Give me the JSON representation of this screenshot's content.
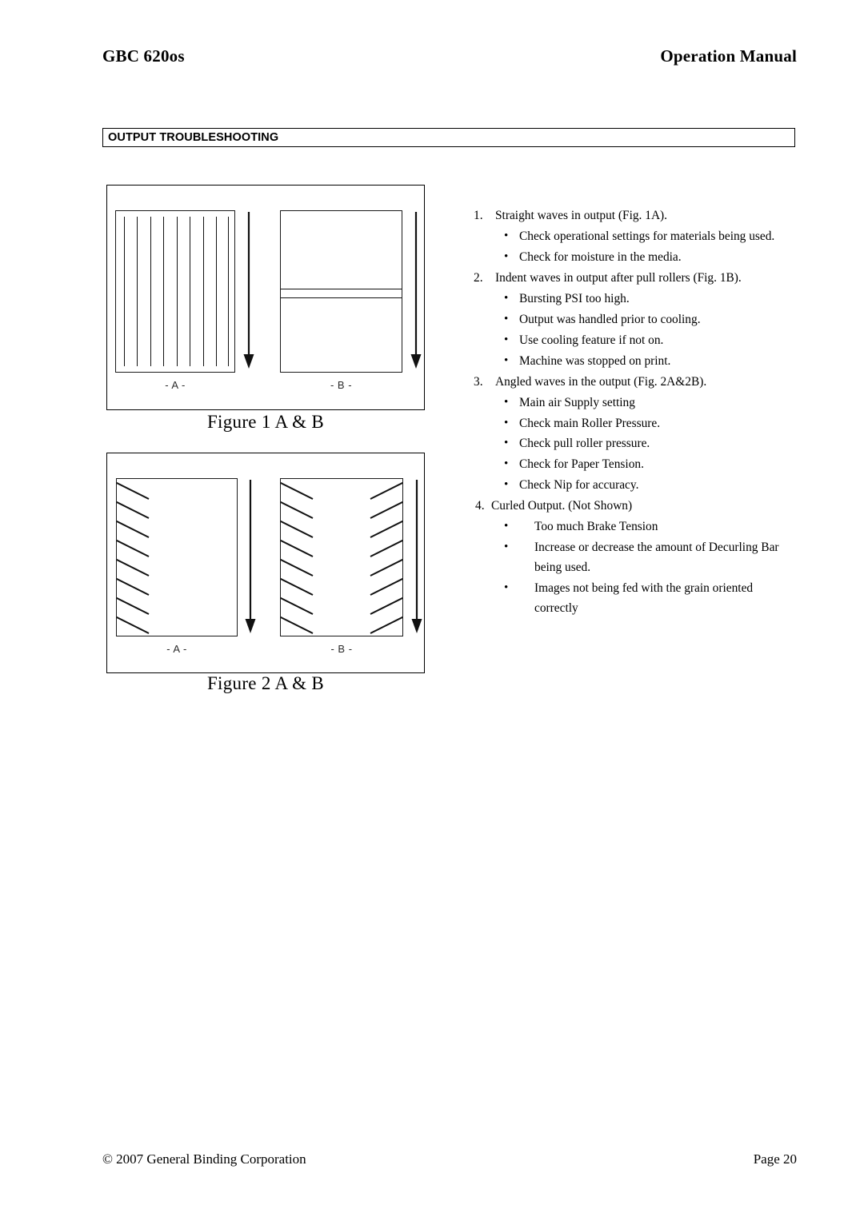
{
  "header": {
    "left_title": "GBC 620os",
    "right_title": "Operation Manual"
  },
  "section": {
    "title": "OUTPUT TROUBLESHOOTING"
  },
  "figures": [
    {
      "caption": "Figure 1 A & B",
      "panels": [
        {
          "label": "- A -",
          "pattern": "vertical-straight-waves",
          "line_count": 9,
          "arrow": "down"
        },
        {
          "label": "- B -",
          "pattern": "horizontal-indent-band",
          "line_count": 2,
          "arrow": "down"
        }
      ]
    },
    {
      "caption": "Figure 2 A & B",
      "panels": [
        {
          "label": "- A -",
          "pattern": "angled-waves-left",
          "line_count": 8,
          "arrow": "down"
        },
        {
          "label": "- B -",
          "pattern": "angled-waves-both-sides",
          "line_count": 16,
          "arrow": "down"
        }
      ]
    }
  ],
  "troubleshooting": [
    {
      "number": "1.",
      "text": "Straight waves in output (Fig. 1A).",
      "bullets": [
        "Check operational settings for materials being used.",
        "Check for moisture in the media."
      ]
    },
    {
      "number": "2.",
      "text": "Indent waves in output after pull rollers (Fig. 1B).",
      "bullets": [
        "Bursting PSI too high.",
        "Output was handled prior to cooling.",
        "Use cooling feature if not on.",
        "Machine was stopped on print."
      ]
    },
    {
      "number": "3.",
      "text": "Angled waves in the output (Fig. 2A&2B).",
      "bullets": [
        "Main air Supply setting",
        "Check main Roller Pressure.",
        "Check pull roller pressure.",
        "Check for Paper Tension.",
        "Check Nip for accuracy."
      ]
    },
    {
      "number": "4.",
      "text": "Curled Output. (Not Shown)",
      "bullets": [
        "Too much Brake Tension",
        "Increase or decrease the amount of Decurling Bar being used.",
        "Images not being fed with the grain oriented correctly"
      ]
    }
  ],
  "footer": {
    "copyright": "© 2007 General Binding Corporation",
    "page": "Page 20"
  },
  "colors": {
    "ink": "#000000",
    "rule": "#1a1a1a"
  }
}
